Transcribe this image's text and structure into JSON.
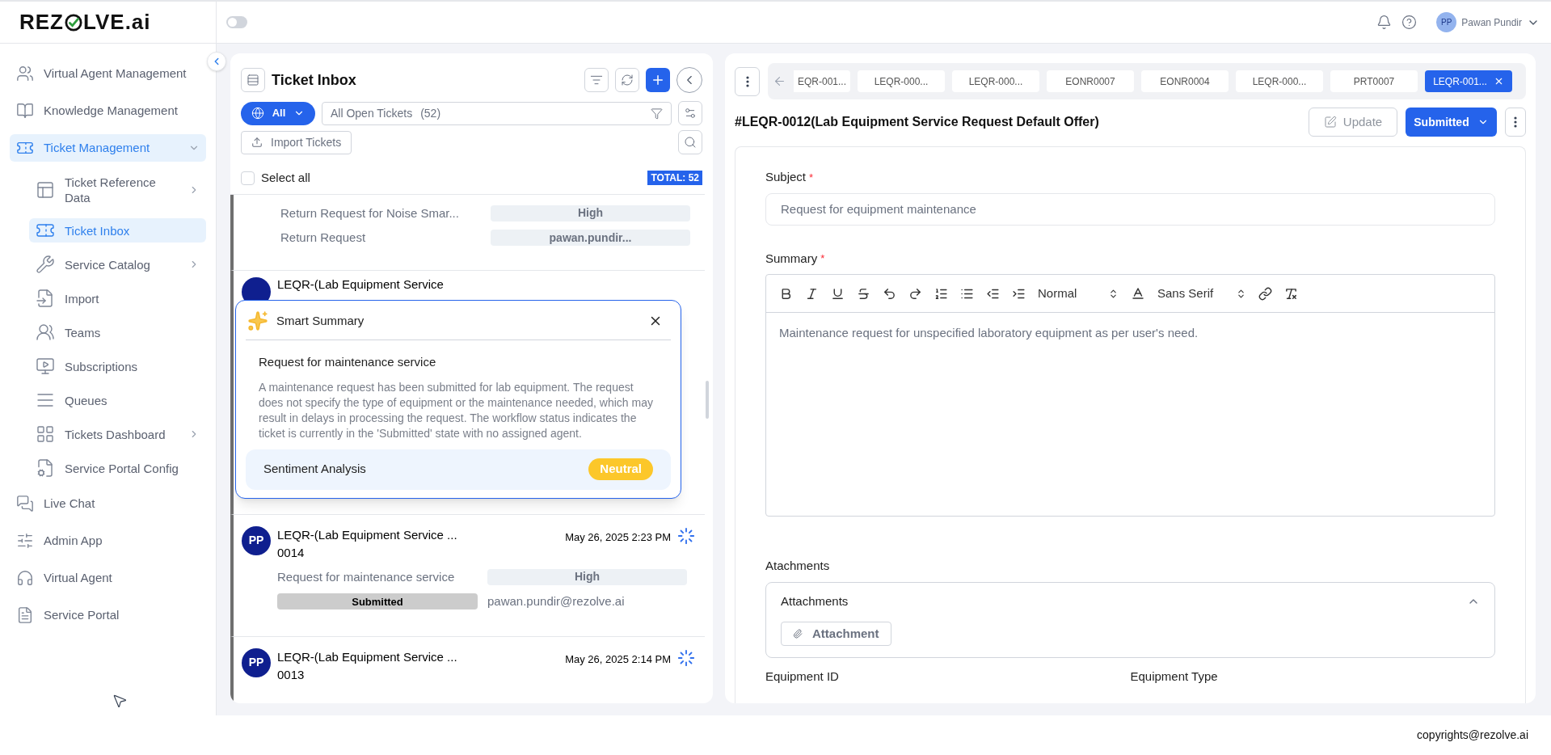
{
  "header": {
    "logo": {
      "before": "REZ",
      "after": "LVE.ai"
    },
    "dark_mode": {
      "on": false
    },
    "user": {
      "initials": "PP",
      "name": "Pawan Pundir"
    }
  },
  "sidebar": {
    "items": [
      {
        "label": "Virtual Agent Management",
        "kind": "link",
        "selected": false
      },
      {
        "label": "Knowledge Management",
        "kind": "link",
        "selected": false
      },
      {
        "label": "Ticket Management",
        "kind": "group",
        "selected": true,
        "expanded": true,
        "children": [
          {
            "label": "Ticket Reference Data",
            "has_submenu": true,
            "selected": false
          },
          {
            "label": "Ticket Inbox",
            "has_submenu": false,
            "selected": true
          },
          {
            "label": "Service Catalog",
            "has_submenu": true,
            "selected": false
          },
          {
            "label": "Import",
            "has_submenu": false,
            "selected": false
          },
          {
            "label": "Teams",
            "has_submenu": false,
            "selected": false
          },
          {
            "label": "Subscriptions",
            "has_submenu": false,
            "selected": false
          },
          {
            "label": "Queues",
            "has_submenu": false,
            "selected": false
          },
          {
            "label": "Tickets Dashboard",
            "has_submenu": true,
            "selected": false
          },
          {
            "label": "Service Portal Config",
            "has_submenu": false,
            "selected": false
          }
        ]
      },
      {
        "label": "Live Chat",
        "kind": "link",
        "selected": false
      },
      {
        "label": "Admin App",
        "kind": "link",
        "selected": false
      },
      {
        "label": "Virtual Agent",
        "kind": "link",
        "selected": false
      },
      {
        "label": "Service Portal",
        "kind": "link",
        "selected": false
      }
    ]
  },
  "inbox": {
    "title": "Ticket Inbox",
    "scope": "All",
    "view": "All Open Tickets",
    "count": "(52)",
    "import_label": "Import Tickets",
    "select_all": {
      "label": "Select all",
      "checked": false
    },
    "total": "TOTAL: 52",
    "tickets": [
      {
        "kind": "partial",
        "subject": "Return Request for Noise Smar...",
        "priority": "High",
        "type": "Return Request",
        "assignee": "pawan.pundir..."
      },
      {
        "kind": "covered",
        "title": "LEQR-(Lab Equipment Service"
      },
      {
        "kind": "full",
        "initials": "PP",
        "title": "LEQR-(Lab Equipment Service ...",
        "number": "0014",
        "date": "May 26, 2025 2:23 PM",
        "subject": "Request for maintenance service",
        "priority": "High",
        "status": "Submitted",
        "assignee": "pawan.pundir@rezolve.ai"
      },
      {
        "kind": "cut",
        "initials": "PP",
        "title": "LEQR-(Lab Equipment Service ...",
        "number": "0013",
        "date": "May 26, 2025 2:14 PM"
      }
    ]
  },
  "smart_summary": {
    "title": "Smart Summary",
    "heading": "Request for maintenance service",
    "text": "A maintenance request has been submitted for lab equipment. The request does not specify the type of equipment or the maintenance needed, which may result in delays in processing the request. The workflow status indicates the ticket is currently in the 'Submitted' state with no assigned agent.",
    "sentiment_label": "Sentiment Analysis",
    "sentiment": "Neutral"
  },
  "detail": {
    "tabs": [
      {
        "label": "EQR-001...",
        "selected": false
      },
      {
        "label": "LEQR-000...",
        "selected": false
      },
      {
        "label": "LEQR-000...",
        "selected": false
      },
      {
        "label": "EONR0007",
        "selected": false
      },
      {
        "label": "EONR0004",
        "selected": false
      },
      {
        "label": "LEQR-000...",
        "selected": false
      },
      {
        "label": "PRT0007",
        "selected": false
      },
      {
        "label": "LEQR-001...",
        "selected": true
      }
    ],
    "title": "#LEQR-0012(Lab Equipment Service Request Default Offer)",
    "update": {
      "label": "Update",
      "disabled": true
    },
    "status": "Submitted",
    "form": {
      "subject": {
        "label": "Subject",
        "required_mark": "*",
        "value": "Request for equipment maintenance"
      },
      "summary": {
        "label": "Summary",
        "required_mark": "*",
        "heading_style": "Normal",
        "font": "Sans Serif",
        "text": "Maintenance request for unspecified laboratory equipment as per user's need."
      },
      "attachments": {
        "label": "Atachments",
        "panel_title": "Attachments",
        "expanded": true,
        "button": "Attachment"
      },
      "fields": [
        "Equipment ID",
        "Equipment Type"
      ]
    }
  },
  "footer": "copyrights@rezolve.ai"
}
